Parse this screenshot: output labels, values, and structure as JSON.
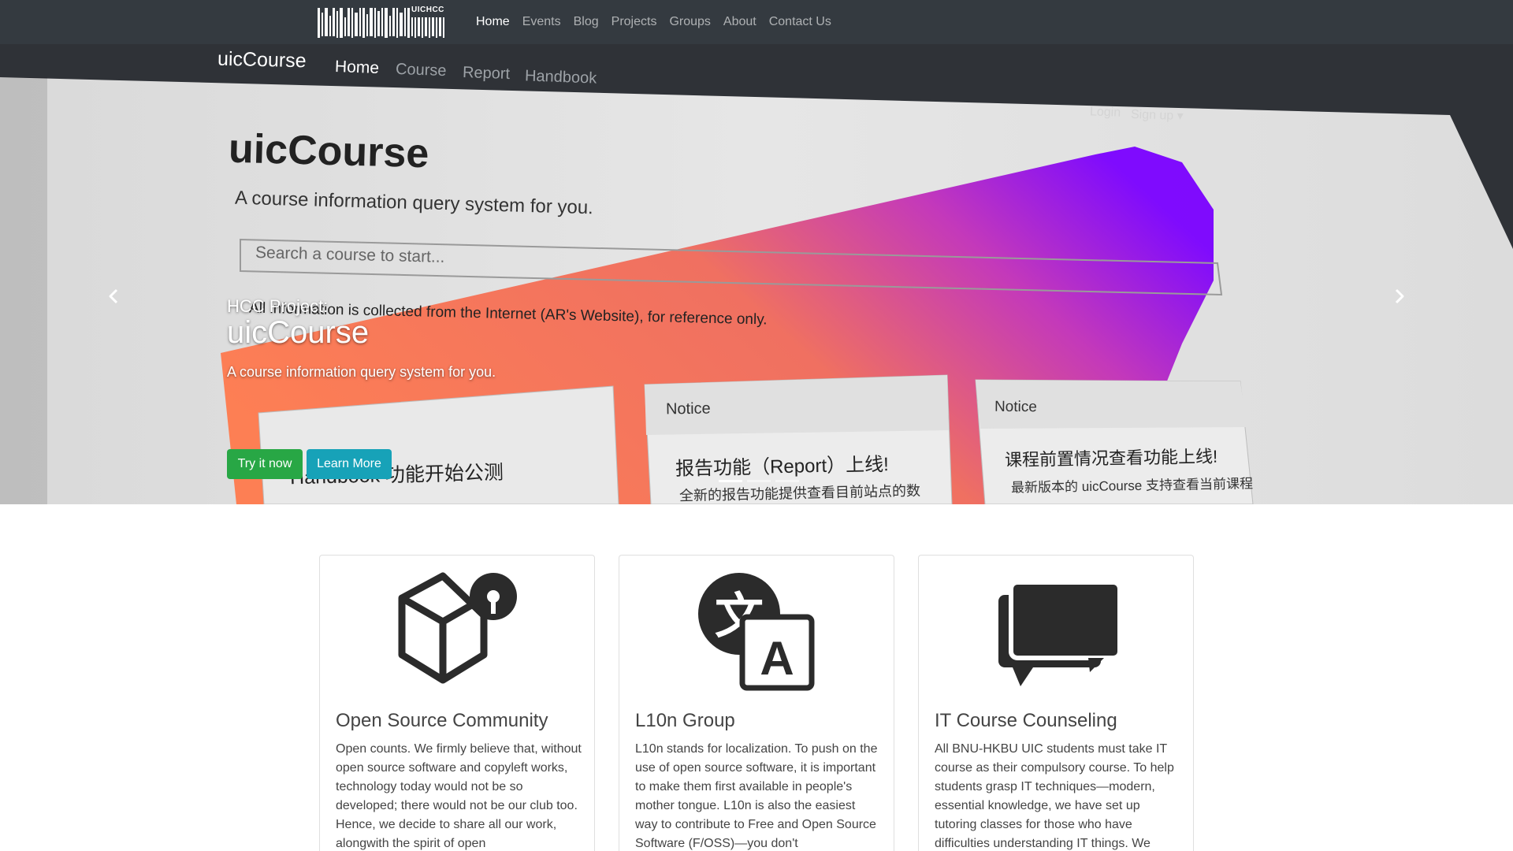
{
  "navbar": {
    "logo_text": "UICHCC",
    "links": [
      "Home",
      "Events",
      "Blog",
      "Projects",
      "Groups",
      "About",
      "Contact Us"
    ]
  },
  "hero": {
    "screenshot": {
      "brand": "uicCourse",
      "nav": [
        "Home",
        "Course",
        "Report",
        "Handbook"
      ],
      "login": "Login",
      "signup": "Sign up ▾",
      "title": "uicCourse",
      "subtitle": "A course information query system for you.",
      "search_placeholder": "Search a course to start...",
      "disclaimer": "All information is collected from the Internet (AR's Website), for reference only.",
      "cards": [
        {
          "header": "",
          "body": "Handbook 功能开始公测"
        },
        {
          "header": "Notice",
          "body": "报告功能（Report）上线!"
        },
        {
          "header": "Notice",
          "body": "课程前置情况查看功能上线!"
        }
      ],
      "card_sub": [
        "全新的报告功能提供查看目前站点的数",
        "最新版本的 uicCourse 支持查看当前课程"
      ]
    },
    "caption": {
      "project_label": "HCC Project:",
      "title": "uicCourse",
      "description": "A course information query system for you."
    },
    "buttons": {
      "try": "Try it now",
      "learn": "Learn More"
    },
    "prev_icon": "chevron-left-icon",
    "next_icon": "chevron-right-icon",
    "indicator_count": 3,
    "active_indicator": 0
  },
  "cards": [
    {
      "icon": "open-source-box-icon",
      "title": "Open Source Community",
      "text": "Open counts. We firmly believe that, without open source software and copyleft works, technology today would not be so developed; there would not be our club too. Hence, we decide to share all our work, alongwith the spirit of open"
    },
    {
      "icon": "translate-icon",
      "title": "L10n Group",
      "text": "L10n stands for localization. To push on the use of open source software, it is important to make them first available in people's mother tongue. L10n is also the easiest way to contribute to Free and Open Source Software (F/OSS)—you don't"
    },
    {
      "icon": "comments-icon",
      "title": "IT Course Counseling",
      "text": "All BNU-HKBU UIC students must take IT course as their compulsory course. To help students grasp IT techniques—modern, essential knowledge, we have set up tutoring classes for those who have difficulties understanding IT things. We"
    }
  ],
  "colors": {
    "navbar_bg": "#343a40",
    "success": "#28a745",
    "info": "#17a2b8",
    "gradient_start": "#ff7a45",
    "gradient_end": "#7a00ff"
  }
}
